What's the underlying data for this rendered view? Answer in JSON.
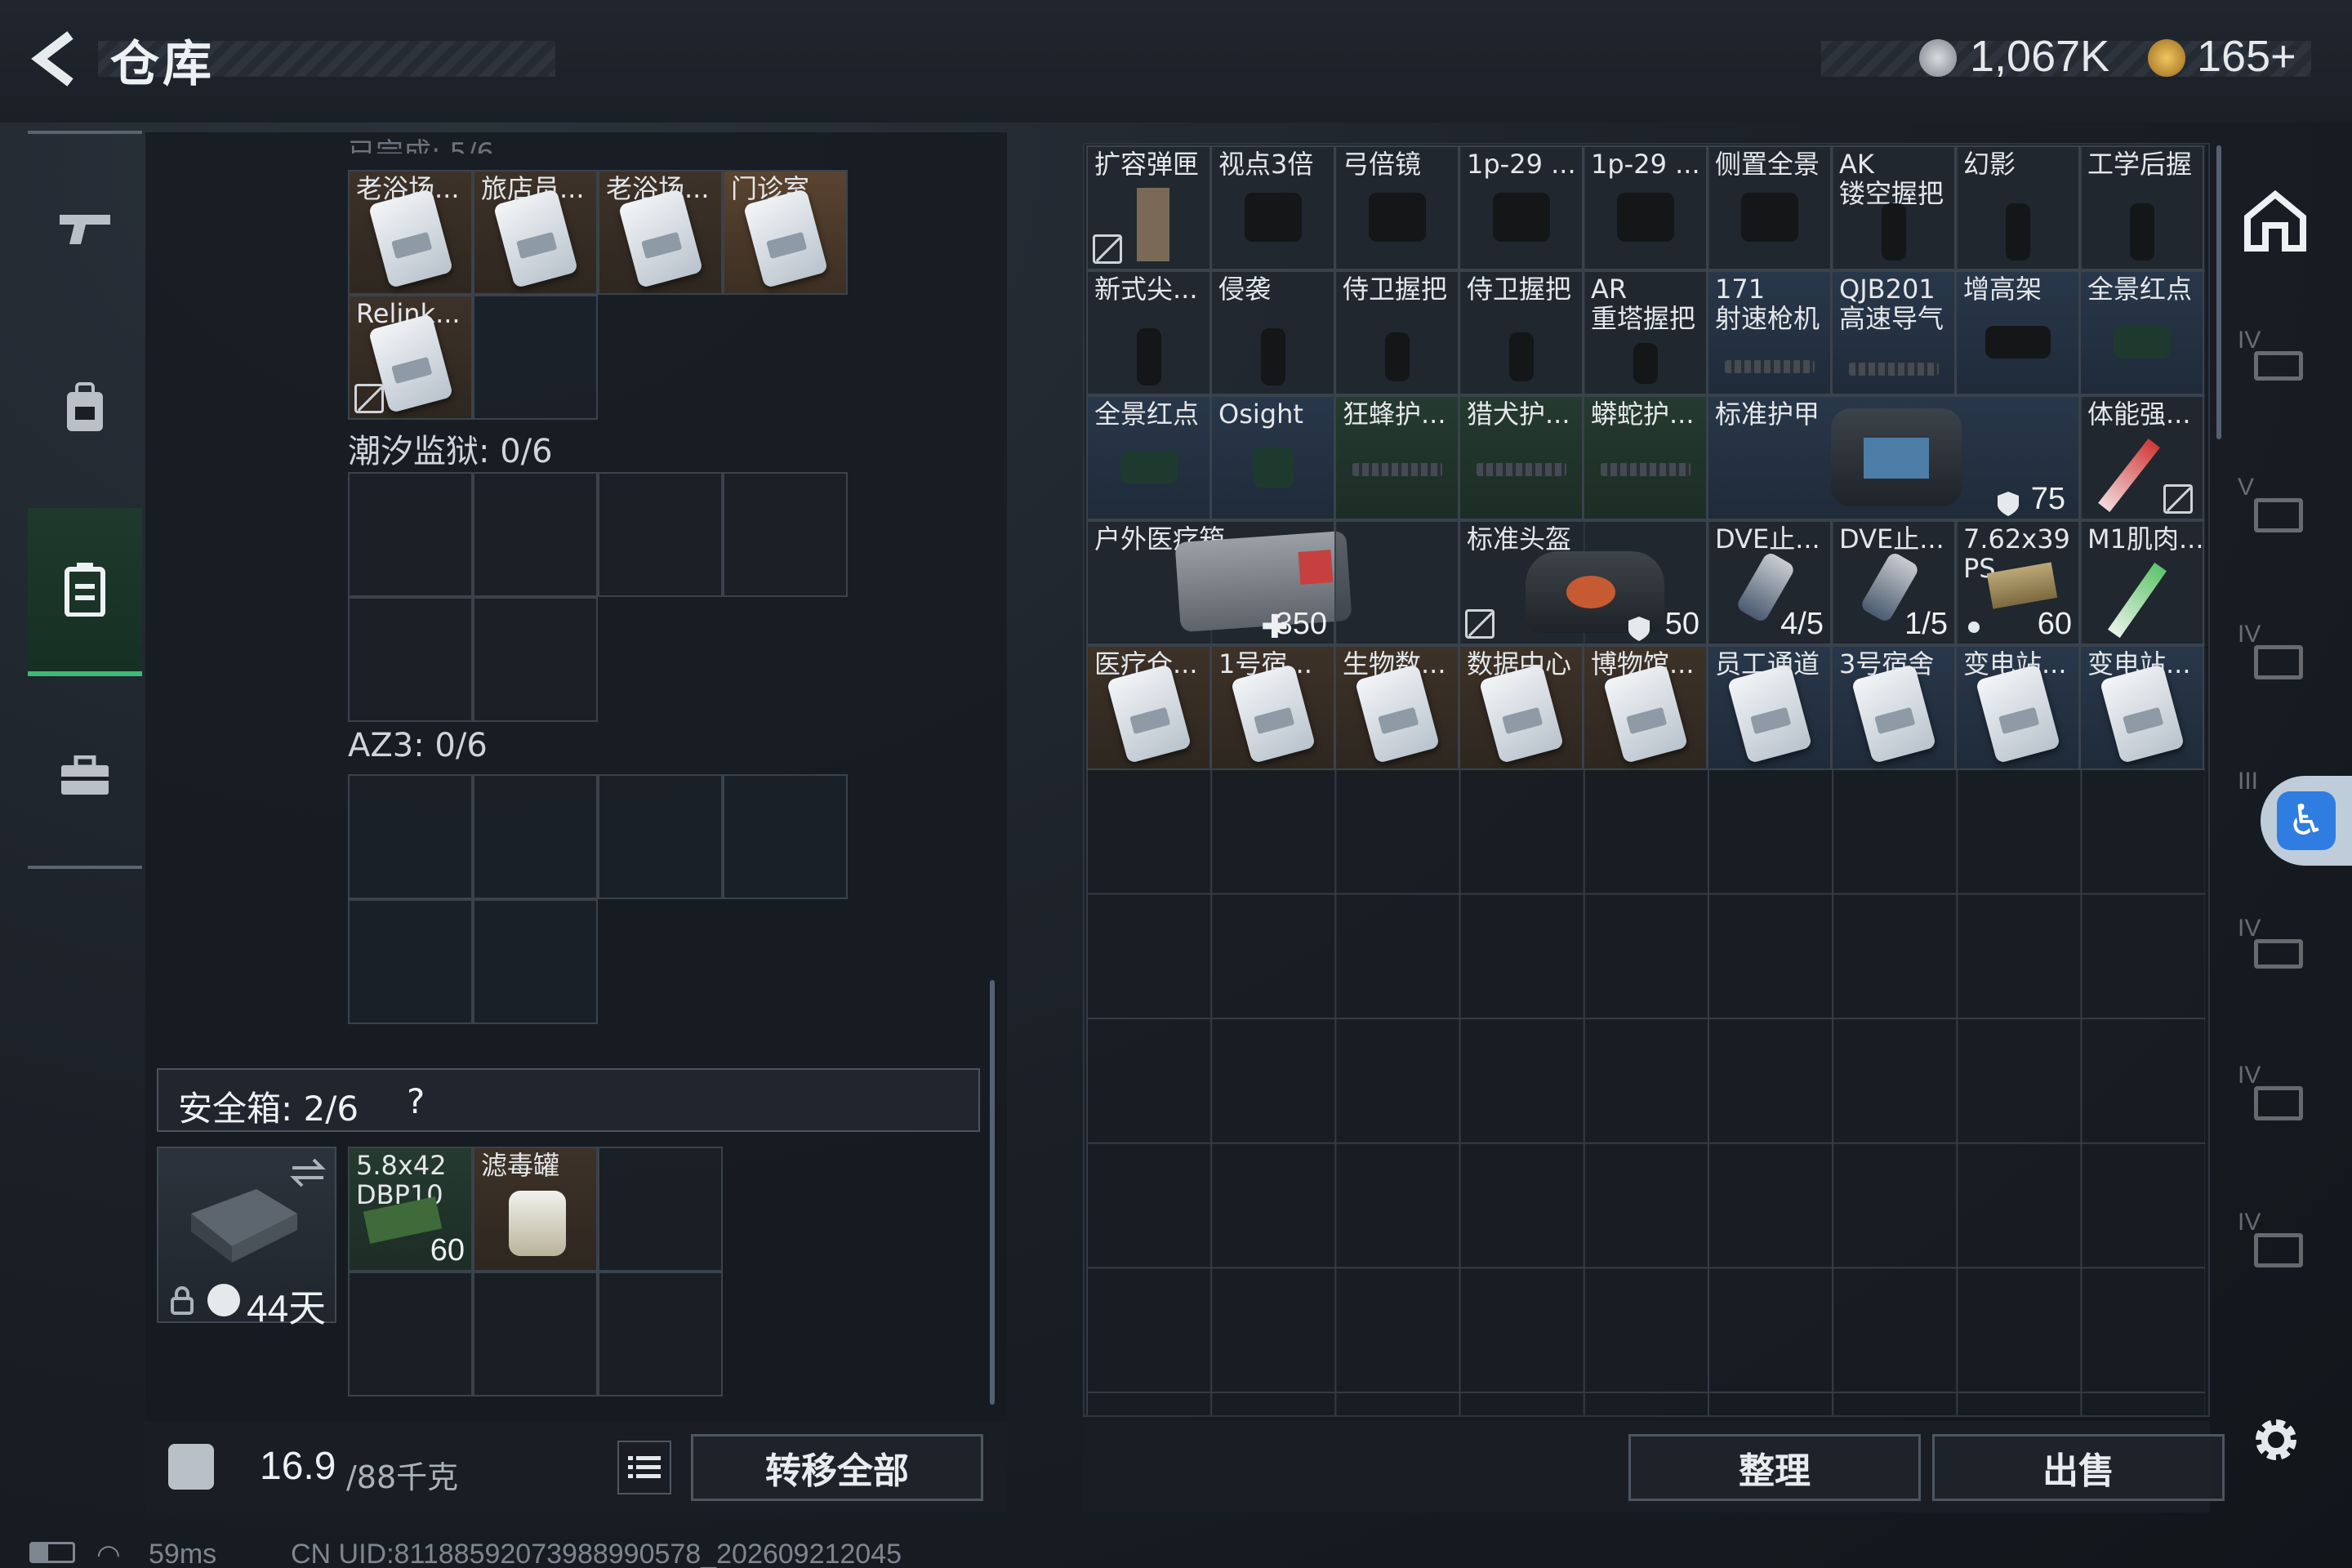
{
  "header": {
    "title": "仓库",
    "currency_1": "1,067K",
    "currency_2": "165+",
    "colors": {
      "accent_green": "#3dba74",
      "coin_silver": "#b7bcc2",
      "coin_gold": "#c99a3a"
    }
  },
  "nav": {
    "items": [
      "gun-icon",
      "backpack-icon",
      "locker-icon",
      "toolbox-icon"
    ],
    "active_index": 2
  },
  "left": {
    "keycards_top": [
      "老浴场...",
      "旅店员...",
      "老浴场...",
      "门诊室"
    ],
    "keycard_row2": "Relink...",
    "section_tide": "潮汐监狱: 0/6",
    "section_az3": "AZ3: 0/6",
    "safe_box_title": "安全箱: 2/6",
    "safe_box_help": "?",
    "safe_box_days": "44天",
    "safe_items": [
      {
        "label": "5.8x42\nDBP10",
        "count": "60"
      },
      {
        "label": "滤毒罐",
        "count": ""
      }
    ],
    "weight": "16.9",
    "weight_max": "/88千克",
    "transfer_all": "转移全部"
  },
  "grid": {
    "row1": [
      "扩容弹匣",
      "视点3倍",
      "弓倍镜",
      "1p-29 ...",
      "1p-29 ...",
      "侧置全景",
      "AK\n镂空握把",
      "幻影",
      "工学后握"
    ],
    "row2": [
      "新式尖...",
      "侵袭",
      "侍卫握把",
      "侍卫握把",
      "AR\n重塔握把",
      "171\n射速枪机",
      "QJB201\n高速导气",
      "增高架",
      "全景红点"
    ],
    "row3": [
      "全景红点",
      "Osight",
      "狂蜂护...",
      "猎犬护...",
      "蟒蛇护...",
      "标准护甲",
      "体能强..."
    ],
    "armor_value": "75",
    "row4": [
      "户外医疗箱",
      "标准头盔",
      "DVE止...",
      "DVE止...",
      "7.62x39\nPS",
      "M1肌肉..."
    ],
    "medkit_value": "350",
    "helmet_value": "50",
    "dve1_count": "4/5",
    "dve2_count": "1/5",
    "ammo_count": "60",
    "row5": [
      "医疗仓...",
      "1号宿...",
      "生物数...",
      "数据中心",
      "博物馆...",
      "员工通道",
      "3号宿舍",
      "变电站...",
      "变电站..."
    ],
    "sort_button": "整理",
    "sell_button": "出售"
  },
  "side_tabs": [
    "IV",
    "V",
    "IV",
    "III",
    "IV",
    "IV",
    "IV"
  ],
  "status": {
    "ping": "59ms",
    "uid": "CN UID:81188592073988990578_202609212045"
  }
}
